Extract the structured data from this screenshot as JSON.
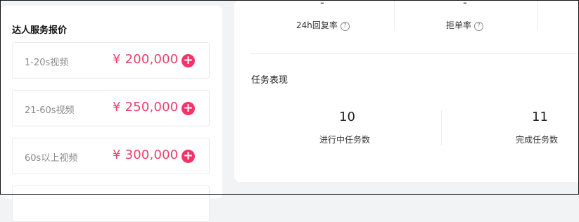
{
  "pricing": {
    "title": "达人服务报价",
    "items": [
      {
        "label": "1-20s视频",
        "price": "¥ 200,000"
      },
      {
        "label": "21-60s视频",
        "price": "¥ 250,000"
      },
      {
        "label": "60s以上视频",
        "price": "¥ 300,000"
      }
    ],
    "add_glyph": "+"
  },
  "stats": {
    "reply_rate": {
      "value": "-",
      "label": "24h回复率"
    },
    "reject_rate": {
      "value": "-",
      "label": "拒单率"
    },
    "help_glyph": "?"
  },
  "tasks": {
    "title": "任务表现",
    "in_progress": {
      "count": "10",
      "label": "进行中任务数"
    },
    "completed": {
      "count": "11",
      "label": "完成任务数"
    }
  },
  "colors": {
    "accent": "#f4336a",
    "price": "#f0406b"
  }
}
